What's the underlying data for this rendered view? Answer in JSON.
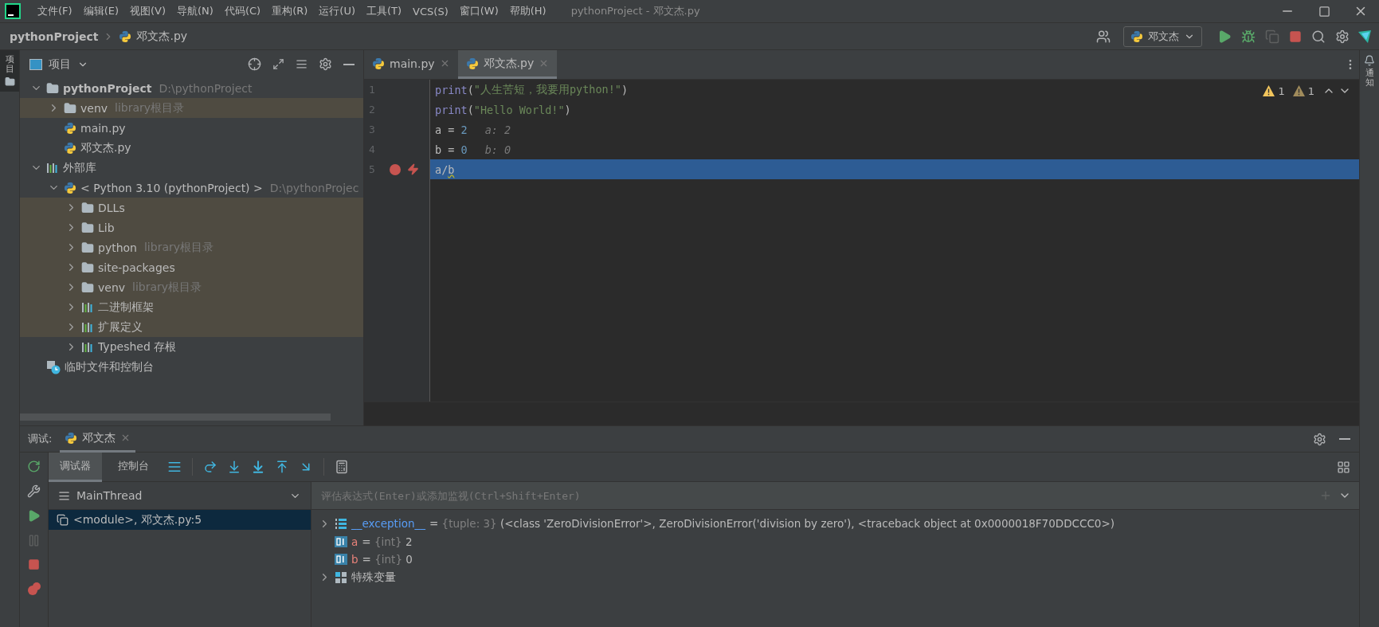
{
  "title_bar": {
    "menus": [
      "文件(F)",
      "编辑(E)",
      "视图(V)",
      "导航(N)",
      "代码(C)",
      "重构(R)",
      "运行(U)",
      "工具(T)",
      "VCS(S)",
      "窗口(W)",
      "帮助(H)"
    ],
    "title": "pythonProject - 邓文杰.py"
  },
  "nav_bar": {
    "breadcrumbs": [
      "pythonProject",
      "邓文杰.py"
    ],
    "run_config": "邓文杰"
  },
  "left_stripe": {
    "tabs": [
      {
        "label": "项目",
        "selected": true
      }
    ]
  },
  "right_stripe": {
    "tabs": [
      {
        "label": "通知",
        "selected": false
      }
    ]
  },
  "project_panel": {
    "title": "项目",
    "tree": [
      {
        "kind": "folder",
        "label": "pythonProject",
        "hint": "D:\\pythonProject",
        "bold": true,
        "expanded": true,
        "library": false,
        "children": [
          {
            "kind": "folder",
            "label": "venv",
            "hint": "library根目录",
            "expanded": false,
            "library": true
          },
          {
            "kind": "python-file",
            "label": "main.py",
            "library": false
          },
          {
            "kind": "python-file",
            "label": "邓文杰.py",
            "library": false
          }
        ]
      },
      {
        "kind": "library",
        "label": "外部库",
        "expanded": true,
        "library": false,
        "children": [
          {
            "kind": "python-sdk",
            "label": "< Python 3.10 (pythonProject) >",
            "hint": "D:\\pythonProjec",
            "expanded": true,
            "library": false,
            "children": [
              {
                "kind": "folder",
                "label": "DLLs",
                "expanded": false,
                "library": true
              },
              {
                "kind": "folder",
                "label": "Lib",
                "expanded": false,
                "library": true
              },
              {
                "kind": "folder",
                "label": "python",
                "hint": "library根目录",
                "expanded": false,
                "library": true
              },
              {
                "kind": "folder",
                "label": "site-packages",
                "expanded": false,
                "library": true
              },
              {
                "kind": "folder",
                "label": "venv",
                "hint": "library根目录",
                "expanded": false,
                "library": true
              },
              {
                "kind": "library",
                "label": "二进制框架",
                "expanded": false,
                "library": true
              },
              {
                "kind": "library",
                "label": "扩展定义",
                "expanded": false,
                "library": true
              },
              {
                "kind": "library",
                "label": "Typeshed 存根",
                "expanded": false,
                "library": false
              }
            ]
          }
        ]
      },
      {
        "kind": "scratch",
        "label": "临时文件和控制台",
        "library": false
      }
    ]
  },
  "editor": {
    "tabs": [
      {
        "label": "main.py",
        "selected": false
      },
      {
        "label": "邓文杰.py",
        "selected": true
      }
    ],
    "inspections": {
      "warnings": "1",
      "weak_warnings": "1"
    },
    "lines": [
      {
        "number": "1",
        "breakpoint": false,
        "exception": false,
        "current": false,
        "tokens": [
          {
            "kind": "builtin",
            "text": "print"
          },
          {
            "kind": "plain",
            "text": "("
          },
          {
            "kind": "string",
            "text": "\"人生苦短，我要用python!\""
          },
          {
            "kind": "plain",
            "text": ")"
          }
        ]
      },
      {
        "number": "2",
        "breakpoint": false,
        "exception": false,
        "current": false,
        "tokens": [
          {
            "kind": "builtin",
            "text": "print"
          },
          {
            "kind": "plain",
            "text": "("
          },
          {
            "kind": "string",
            "text": "\"Hello World!\""
          },
          {
            "kind": "plain",
            "text": ")"
          }
        ]
      },
      {
        "number": "3",
        "breakpoint": false,
        "exception": false,
        "current": false,
        "tokens": [
          {
            "kind": "plain",
            "text": "a = "
          },
          {
            "kind": "number",
            "text": "2"
          }
        ],
        "inline_value": "a: 2"
      },
      {
        "number": "4",
        "breakpoint": false,
        "exception": false,
        "current": false,
        "tokens": [
          {
            "kind": "plain",
            "text": "b = "
          },
          {
            "kind": "number",
            "text": "0"
          }
        ],
        "inline_value": "b: 0"
      },
      {
        "number": "5",
        "breakpoint": true,
        "exception": true,
        "current": true,
        "tokens": [
          {
            "kind": "plain",
            "text": "a/"
          },
          {
            "kind": "warn",
            "text": "b"
          }
        ]
      }
    ]
  },
  "debug": {
    "title": "调试:",
    "session": "邓文杰",
    "tabs": [
      {
        "label": "调试器",
        "selected": true
      },
      {
        "label": "控制台",
        "selected": false
      }
    ],
    "thread": "MainThread",
    "frames": [
      {
        "label": "<module>, 邓文杰.py:5",
        "selected": true
      }
    ],
    "watch_placeholder": "评估表达式(Enter)或添加监视(Ctrl+Shift+Enter)",
    "variables": [
      {
        "kind": "tuple",
        "name": "__exception__",
        "sep": "=",
        "type": "{tuple: 3}",
        "value": "(<class 'ZeroDivisionError'>, ZeroDivisionError('division by zero'), <traceback object at 0x0000018F70DDCCC0>)",
        "expandable": true
      },
      {
        "kind": "int",
        "name": "a",
        "sep": "=",
        "type": "{int}",
        "value": "2",
        "expandable": false
      },
      {
        "kind": "int",
        "name": "b",
        "sep": "=",
        "type": "{int}",
        "value": "0",
        "expandable": false
      },
      {
        "kind": "group",
        "name": "特殊变量",
        "expandable": true
      }
    ]
  }
}
